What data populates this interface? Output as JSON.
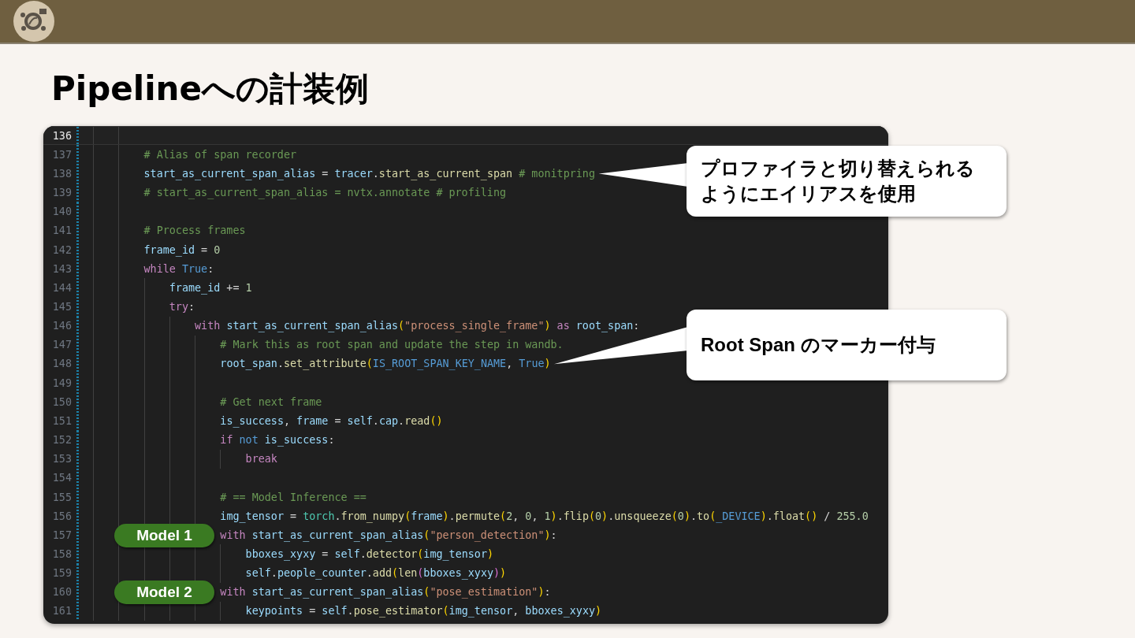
{
  "slide": {
    "title": "Pipelineへの計装例"
  },
  "editor": {
    "lines": [
      {
        "num": "136",
        "current": true
      },
      {
        "num": "137",
        "current": false,
        "tokens": [
          {
            "kind": "comment",
            "text": "# Alias of span recorder"
          }
        ]
      },
      {
        "num": "138",
        "current": false,
        "tokens": [
          {
            "kind": "variable",
            "text": "start_as_current_span_alias"
          },
          {
            "kind": "operator",
            "text": " = "
          },
          {
            "kind": "variable",
            "text": "tracer"
          },
          {
            "kind": "operator",
            "text": "."
          },
          {
            "kind": "function",
            "text": "start_as_current_span "
          },
          {
            "kind": "comment",
            "text": "# monitpring"
          }
        ]
      },
      {
        "num": "139",
        "current": false,
        "tokens": [
          {
            "kind": "comment",
            "text": "# start_as_current_span_alias = nvtx.annotate # profiling"
          }
        ]
      },
      {
        "num": "140",
        "current": false
      },
      {
        "num": "141",
        "current": false,
        "tokens": [
          {
            "kind": "comment",
            "text": "# Process frames"
          }
        ]
      },
      {
        "num": "142",
        "current": false,
        "tokens": [
          {
            "kind": "variable",
            "text": "frame_id"
          },
          {
            "kind": "operator",
            "text": " = "
          },
          {
            "kind": "number",
            "text": "0"
          }
        ]
      },
      {
        "num": "143",
        "current": false,
        "tokens": [
          {
            "kind": "keyword",
            "text": "while "
          },
          {
            "kind": "constant",
            "text": "True"
          },
          {
            "kind": "operator",
            "text": ":"
          }
        ],
        "children": [
          {
            "num": "144",
            "current": false,
            "tokens": [
              {
                "kind": "variable",
                "text": "frame_id"
              },
              {
                "kind": "operator",
                "text": " += "
              },
              {
                "kind": "number",
                "text": "1"
              }
            ]
          },
          {
            "num": "145",
            "current": false,
            "tokens": [
              {
                "kind": "keyword",
                "text": "try"
              },
              {
                "kind": "operator",
                "text": ":"
              }
            ],
            "children": [
              {
                "num": "146",
                "current": false,
                "tokens": [
                  {
                    "kind": "keyword",
                    "text": "with "
                  },
                  {
                    "kind": "variable",
                    "text": "start_as_current_span_alias"
                  },
                  {
                    "kind": "bracket",
                    "text": "("
                  },
                  {
                    "kind": "string",
                    "text": "\"process_single_frame\""
                  },
                  {
                    "kind": "bracket",
                    "text": ")"
                  },
                  {
                    "kind": "keyword",
                    "text": " as "
                  },
                  {
                    "kind": "variable",
                    "text": "root_span"
                  },
                  {
                    "kind": "operator",
                    "text": ":"
                  }
                ],
                "children": [
                  {
                    "num": "147",
                    "current": false,
                    "tokens": [
                      {
                        "kind": "comment",
                        "text": "# Mark this as root span and update the step in wandb."
                      }
                    ]
                  },
                  {
                    "num": "148",
                    "current": false,
                    "tokens": [
                      {
                        "kind": "variable",
                        "text": "root_span"
                      },
                      {
                        "kind": "operator",
                        "text": "."
                      },
                      {
                        "kind": "function",
                        "text": "set_attribute"
                      },
                      {
                        "kind": "bracket",
                        "text": "("
                      },
                      {
                        "kind": "constant",
                        "text": "IS_ROOT_SPAN_KEY_NAME"
                      },
                      {
                        "kind": "operator",
                        "text": ", "
                      },
                      {
                        "kind": "constant",
                        "text": "True"
                      },
                      {
                        "kind": "bracket",
                        "text": ")"
                      }
                    ]
                  },
                  {
                    "num": "149",
                    "current": false
                  },
                  {
                    "num": "150",
                    "current": false,
                    "tokens": [
                      {
                        "kind": "comment",
                        "text": "# Get next frame"
                      }
                    ]
                  },
                  {
                    "num": "151",
                    "current": false,
                    "tokens": [
                      {
                        "kind": "variable",
                        "text": "is_success"
                      },
                      {
                        "kind": "operator",
                        "text": ", "
                      },
                      {
                        "kind": "variable",
                        "text": "frame"
                      },
                      {
                        "kind": "operator",
                        "text": " = "
                      },
                      {
                        "kind": "variable",
                        "text": "self"
                      },
                      {
                        "kind": "operator",
                        "text": "."
                      },
                      {
                        "kind": "variable",
                        "text": "cap"
                      },
                      {
                        "kind": "operator",
                        "text": "."
                      },
                      {
                        "kind": "function",
                        "text": "read"
                      },
                      {
                        "kind": "bracket",
                        "text": "()"
                      }
                    ]
                  },
                  {
                    "num": "152",
                    "current": false,
                    "tokens": [
                      {
                        "kind": "keyword",
                        "text": "if "
                      },
                      {
                        "kind": "constant",
                        "text": "not"
                      },
                      {
                        "kind": "variable",
                        "text": " is_success"
                      },
                      {
                        "kind": "operator",
                        "text": ":"
                      }
                    ],
                    "children": [
                      {
                        "num": "153",
                        "current": false,
                        "tokens": [
                          {
                            "kind": "keyword",
                            "text": "break"
                          }
                        ]
                      }
                    ]
                  },
                  {
                    "num": "154",
                    "current": false
                  },
                  {
                    "num": "155",
                    "current": false,
                    "tokens": [
                      {
                        "kind": "comment",
                        "text": "# == Model Inference =="
                      }
                    ]
                  },
                  {
                    "num": "156",
                    "current": false,
                    "tokens": [
                      {
                        "kind": "variable",
                        "text": "img_tensor"
                      },
                      {
                        "kind": "operator",
                        "text": " = "
                      },
                      {
                        "kind": "module",
                        "text": "torch"
                      },
                      {
                        "kind": "operator",
                        "text": "."
                      },
                      {
                        "kind": "function",
                        "text": "from_numpy"
                      },
                      {
                        "kind": "bracket",
                        "text": "("
                      },
                      {
                        "kind": "variable",
                        "text": "frame"
                      },
                      {
                        "kind": "bracket",
                        "text": ")"
                      },
                      {
                        "kind": "operator",
                        "text": "."
                      },
                      {
                        "kind": "function",
                        "text": "permute"
                      },
                      {
                        "kind": "bracket",
                        "text": "("
                      },
                      {
                        "kind": "number",
                        "text": "2"
                      },
                      {
                        "kind": "operator",
                        "text": ", "
                      },
                      {
                        "kind": "number",
                        "text": "0"
                      },
                      {
                        "kind": "operator",
                        "text": ", "
                      },
                      {
                        "kind": "number",
                        "text": "1"
                      },
                      {
                        "kind": "bracket",
                        "text": ")"
                      },
                      {
                        "kind": "operator",
                        "text": "."
                      },
                      {
                        "kind": "function",
                        "text": "flip"
                      },
                      {
                        "kind": "bracket",
                        "text": "("
                      },
                      {
                        "kind": "number",
                        "text": "0"
                      },
                      {
                        "kind": "bracket",
                        "text": ")"
                      },
                      {
                        "kind": "operator",
                        "text": "."
                      },
                      {
                        "kind": "function",
                        "text": "unsqueeze"
                      },
                      {
                        "kind": "bracket",
                        "text": "("
                      },
                      {
                        "kind": "number",
                        "text": "0"
                      },
                      {
                        "kind": "bracket",
                        "text": ")"
                      },
                      {
                        "kind": "operator",
                        "text": "."
                      },
                      {
                        "kind": "function",
                        "text": "to"
                      },
                      {
                        "kind": "bracket",
                        "text": "("
                      },
                      {
                        "kind": "constant",
                        "text": "_DEVICE"
                      },
                      {
                        "kind": "bracket",
                        "text": ")"
                      },
                      {
                        "kind": "operator",
                        "text": "."
                      },
                      {
                        "kind": "function",
                        "text": "float"
                      },
                      {
                        "kind": "bracket",
                        "text": "()"
                      },
                      {
                        "kind": "operator",
                        "text": " / "
                      },
                      {
                        "kind": "number",
                        "text": "255.0"
                      }
                    ]
                  },
                  {
                    "num": "157",
                    "current": false,
                    "tokens": [
                      {
                        "kind": "keyword",
                        "text": "with "
                      },
                      {
                        "kind": "variable",
                        "text": "start_as_current_span_alias"
                      },
                      {
                        "kind": "bracket",
                        "text": "("
                      },
                      {
                        "kind": "string",
                        "text": "\"person_detection\""
                      },
                      {
                        "kind": "bracket",
                        "text": ")"
                      },
                      {
                        "kind": "operator",
                        "text": ":"
                      }
                    ],
                    "children": [
                      {
                        "num": "158",
                        "current": false,
                        "tokens": [
                          {
                            "kind": "variable",
                            "text": "bboxes_xyxy"
                          },
                          {
                            "kind": "operator",
                            "text": " = "
                          },
                          {
                            "kind": "variable",
                            "text": "self"
                          },
                          {
                            "kind": "operator",
                            "text": "."
                          },
                          {
                            "kind": "function",
                            "text": "detector"
                          },
                          {
                            "kind": "bracket",
                            "text": "("
                          },
                          {
                            "kind": "variable",
                            "text": "img_tensor"
                          },
                          {
                            "kind": "bracket",
                            "text": ")"
                          }
                        ]
                      },
                      {
                        "num": "159",
                        "current": false,
                        "tokens": [
                          {
                            "kind": "variable",
                            "text": "self"
                          },
                          {
                            "kind": "operator",
                            "text": "."
                          },
                          {
                            "kind": "variable",
                            "text": "people_counter"
                          },
                          {
                            "kind": "operator",
                            "text": "."
                          },
                          {
                            "kind": "function",
                            "text": "add"
                          },
                          {
                            "kind": "bracket",
                            "text": "("
                          },
                          {
                            "kind": "function",
                            "text": "len"
                          },
                          {
                            "kind": "inner_bracket",
                            "text": "("
                          },
                          {
                            "kind": "variable",
                            "text": "bboxes_xyxy"
                          },
                          {
                            "kind": "inner_bracket",
                            "text": ")"
                          },
                          {
                            "kind": "bracket",
                            "text": ")"
                          }
                        ]
                      }
                    ]
                  },
                  {
                    "num": "160",
                    "current": false,
                    "tokens": [
                      {
                        "kind": "keyword",
                        "text": "with "
                      },
                      {
                        "kind": "variable",
                        "text": "start_as_current_span_alias"
                      },
                      {
                        "kind": "bracket",
                        "text": "("
                      },
                      {
                        "kind": "string",
                        "text": "\"pose_estimation\""
                      },
                      {
                        "kind": "bracket",
                        "text": ")"
                      },
                      {
                        "kind": "operator",
                        "text": ":"
                      }
                    ],
                    "children": [
                      {
                        "num": "161",
                        "current": false,
                        "tokens": [
                          {
                            "kind": "variable",
                            "text": "keypoints"
                          },
                          {
                            "kind": "operator",
                            "text": " = "
                          },
                          {
                            "kind": "variable",
                            "text": "self"
                          },
                          {
                            "kind": "operator",
                            "text": "."
                          },
                          {
                            "kind": "function",
                            "text": "pose_estimator"
                          },
                          {
                            "kind": "bracket",
                            "text": "("
                          },
                          {
                            "kind": "variable",
                            "text": "img_tensor"
                          },
                          {
                            "kind": "operator",
                            "text": ", "
                          },
                          {
                            "kind": "variable",
                            "text": "bboxes_xyxy"
                          },
                          {
                            "kind": "bracket",
                            "text": ")"
                          }
                        ]
                      }
                    ]
                  }
                ]
              }
            ]
          }
        ]
      }
    ]
  },
  "callouts": [
    {
      "text": "プロファイラと切り替えられるようにエイリアスを使用"
    },
    {
      "text": "Root Span のマーカー付与"
    }
  ],
  "badges": [
    {
      "text": "Model 1"
    },
    {
      "text": "Model 2"
    }
  ]
}
